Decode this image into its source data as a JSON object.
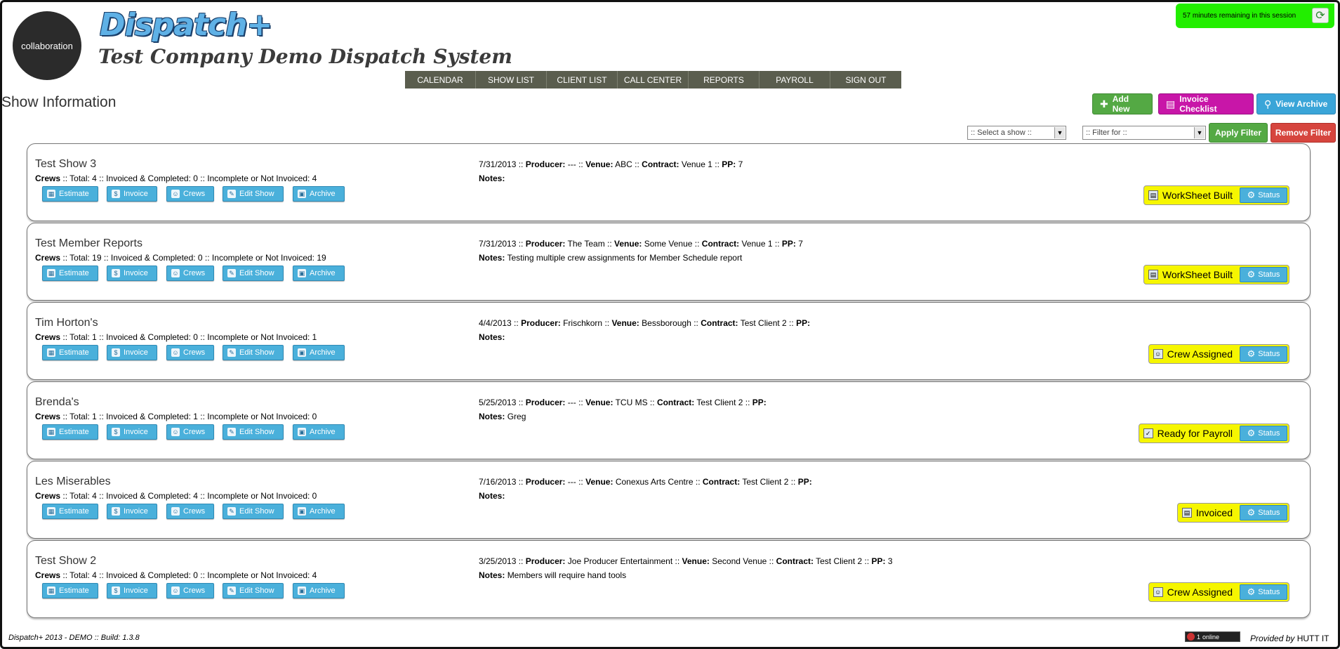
{
  "header": {
    "logo_text": "collaboration",
    "brand": "Dispatch+",
    "company": "Test Company Demo Dispatch System",
    "session_text": "57 minutes remaining in this session"
  },
  "nav": [
    "CALENDAR",
    "SHOW LIST",
    "CLIENT LIST",
    "CALL CENTER",
    "REPORTS",
    "PAYROLL",
    "SIGN OUT"
  ],
  "page_title": "Show Information",
  "toolbar": {
    "add_new": "Add New",
    "invoice_checklist": "Invoice Checklist",
    "view_archive": "View Archive",
    "select_show_placeholder": ":: Select a show ::",
    "filter_placeholder": ":: Filter for ::",
    "apply_filter": "Apply Filter",
    "remove_filter": "Remove Filter"
  },
  "labels": {
    "crews": "Crews",
    "producer": "Producer:",
    "venue": "Venue:",
    "contract": "Contract:",
    "pp": "PP:",
    "notes": "Notes:",
    "estimate": "Estimate",
    "invoice": "Invoice",
    "crews_btn": "Crews",
    "edit_show": "Edit Show",
    "archive": "Archive",
    "status": "Status"
  },
  "shows": [
    {
      "name": "Test Show 3",
      "crews_summary": ":: Total: 4 :: Invoiced & Completed: 0 :: Incomplete or Not Invoiced: 4",
      "date": "7/31/2013",
      "producer": "---",
      "venue": "ABC",
      "contract": "Venue 1",
      "pp": "7",
      "notes": "",
      "status": "WorkSheet Built"
    },
    {
      "name": "Test Member Reports",
      "crews_summary": ":: Total: 19 :: Invoiced & Completed: 0 :: Incomplete or Not Invoiced: 19",
      "date": "7/31/2013",
      "producer": "The Team",
      "venue": "Some Venue",
      "contract": "Venue 1",
      "pp": "7",
      "notes": "Testing multiple crew assignments for Member Schedule report",
      "status": "WorkSheet Built"
    },
    {
      "name": "Tim Horton's",
      "crews_summary": ":: Total: 1 :: Invoiced & Completed: 0 :: Incomplete or Not Invoiced: 1",
      "date": "4/4/2013",
      "producer": "Frischkorn",
      "venue": "Bessborough",
      "contract": "Test Client 2",
      "pp": "",
      "notes": "",
      "status": "Crew Assigned"
    },
    {
      "name": "Brenda's",
      "crews_summary": ":: Total: 1 :: Invoiced & Completed: 1 :: Incomplete or Not Invoiced: 0",
      "date": "5/25/2013",
      "producer": "---",
      "venue": "TCU MS",
      "contract": "Test Client 2",
      "pp": "",
      "notes": "Greg",
      "status": "Ready for Payroll"
    },
    {
      "name": "Les Miserables",
      "crews_summary": ":: Total: 4 :: Invoiced & Completed: 4 :: Incomplete or Not Invoiced: 0",
      "date": "7/16/2013",
      "producer": "---",
      "venue": "Conexus Arts Centre",
      "contract": "Test Client 2",
      "pp": "",
      "notes": "",
      "status": "Invoiced"
    },
    {
      "name": "Test Show 2",
      "crews_summary": ":: Total: 4 :: Invoiced & Completed: 0 :: Incomplete or Not Invoiced: 4",
      "date": "3/25/2013",
      "producer": "Joe Producer Entertainment",
      "venue": "Second Venue",
      "contract": "Test Client 2",
      "pp": "3",
      "notes": "Members will require hand tools",
      "status": "Crew Assigned"
    }
  ],
  "footer": {
    "left": "Dispatch+ 2013 - DEMO :: Build: 1.3.8",
    "online_count": "1",
    "online_label": "online",
    "provided_by": "Provided by",
    "provider": "HUTT IT"
  }
}
